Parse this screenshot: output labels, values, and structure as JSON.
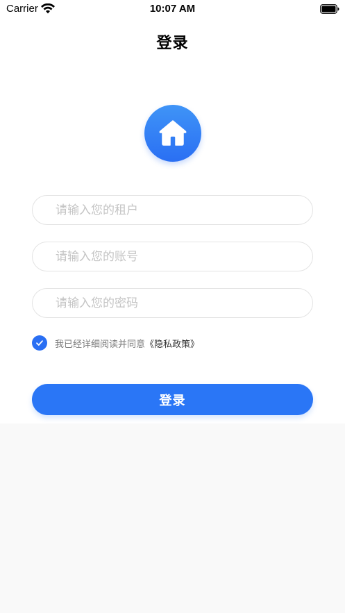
{
  "status_bar": {
    "carrier": "Carrier",
    "time": "10:07 AM"
  },
  "header": {
    "title": "登录"
  },
  "form": {
    "tenant": {
      "value": "",
      "placeholder": "请输入您的租户"
    },
    "account": {
      "value": "",
      "placeholder": "请输入您的账号"
    },
    "password": {
      "value": "",
      "placeholder": "请输入您的密码"
    }
  },
  "agreement": {
    "checked": true,
    "text": "我已经详细阅读并同意",
    "link": "《隐私政策》"
  },
  "actions": {
    "login_label": "登录"
  },
  "icons": {
    "logo": "home-icon",
    "checkbox": "checkmark-icon",
    "wifi": "wifi-icon",
    "battery": "battery-icon"
  },
  "colors": {
    "accent": "#2a76f6",
    "logo_top": "#3f94f7",
    "logo_bottom": "#2a6ff3",
    "placeholder": "#c4c4c4",
    "background": "#f9f9f9"
  }
}
